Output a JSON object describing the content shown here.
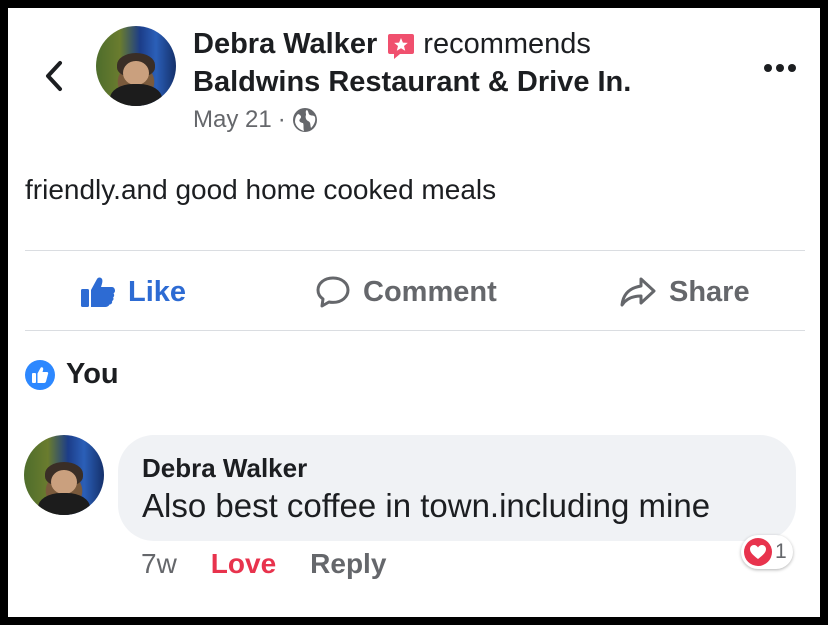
{
  "post": {
    "author": "Debra Walker",
    "action_text": "recommends",
    "place": "Baldwins Restaurant & Drive In.",
    "date": "May 21",
    "separator": "·",
    "text": "friendly.and good home cooked meals"
  },
  "actions": {
    "like": "Like",
    "comment": "Comment",
    "share": "Share"
  },
  "reactions": {
    "liked_by": "You"
  },
  "comment": {
    "author": "Debra Walker",
    "text": "Also best coffee in town.including mine",
    "time": "7w",
    "love_label": "Love",
    "reply_label": "Reply",
    "reaction_count": "1"
  },
  "colors": {
    "like_blue": "#2d6bd3",
    "love_red": "#e8334d",
    "recommend_pink": "#f0506e",
    "secondary_text": "#65676b"
  },
  "icons": {
    "back": "chevron-left-icon",
    "recommend": "recommend-star-icon",
    "privacy": "globe-icon",
    "more": "more-dots-icon",
    "like": "thumbs-up-icon",
    "comment": "comment-bubble-icon",
    "share": "share-arrow-icon",
    "love": "heart-icon"
  }
}
